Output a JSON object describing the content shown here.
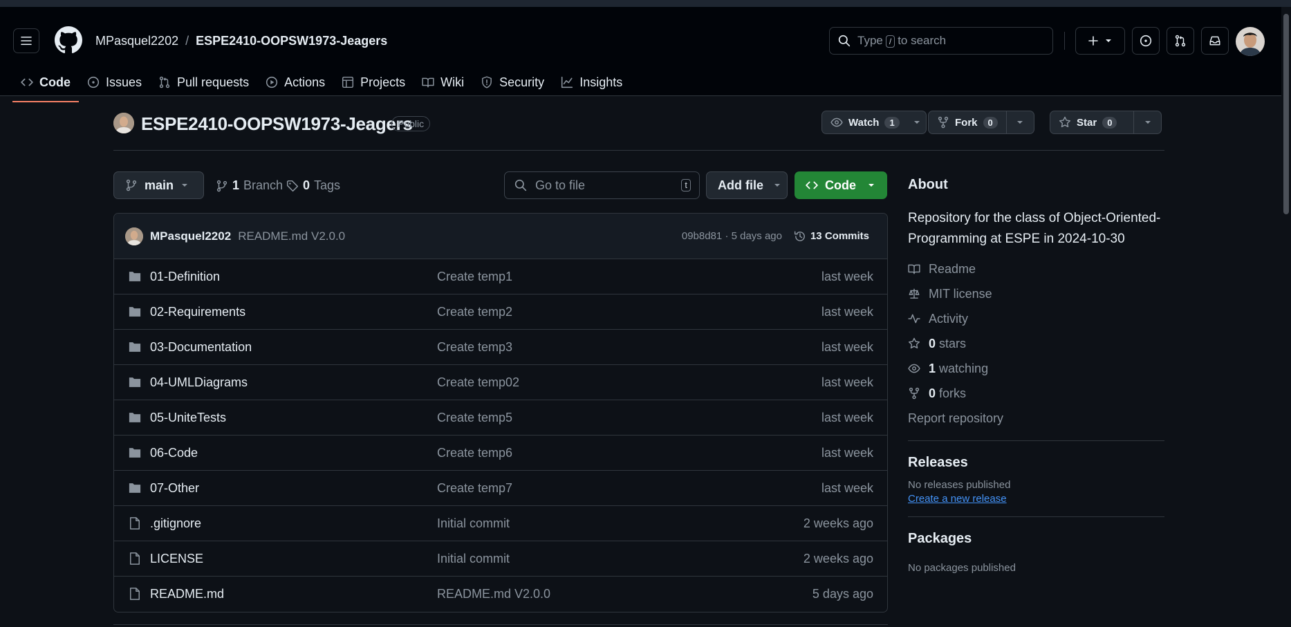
{
  "header": {
    "owner": "MPasquel2202",
    "separator": "/",
    "repo": "ESPE2410-OOPSW1973-Jeagers",
    "search_prefix": "Type",
    "search_key": "/",
    "search_suffix": "to search"
  },
  "tabs": [
    {
      "label": "Code",
      "icon": "code-icon"
    },
    {
      "label": "Issues",
      "icon": "issue-icon"
    },
    {
      "label": "Pull requests",
      "icon": "pull-request-icon"
    },
    {
      "label": "Actions",
      "icon": "play-icon"
    },
    {
      "label": "Projects",
      "icon": "table-icon"
    },
    {
      "label": "Wiki",
      "icon": "book-icon"
    },
    {
      "label": "Security",
      "icon": "shield-icon"
    },
    {
      "label": "Insights",
      "icon": "graph-icon"
    }
  ],
  "repo_header": {
    "title": "ESPE2410-OOPSW1973-Jeagers",
    "visibility": "Public",
    "watch_label": "Watch",
    "watch_count": "1",
    "fork_label": "Fork",
    "fork_count": "0",
    "star_label": "Star",
    "star_count": "0"
  },
  "controls": {
    "branch": "main",
    "branches_count": "1",
    "branches_label": "Branch",
    "tags_count": "0",
    "tags_label": "Tags",
    "go_to_file_placeholder": "Go to file",
    "go_to_file_key": "t",
    "add_file": "Add file",
    "code_button": "Code"
  },
  "latest_commit": {
    "author": "MPasquel2202",
    "message": "README.md V2.0.0",
    "hash_time": "09b8d81 · 5 days ago",
    "commits_label": "13 Commits"
  },
  "files": [
    {
      "type": "folder",
      "name": "01-Definition",
      "message": "Create temp1",
      "time": "last week"
    },
    {
      "type": "folder",
      "name": "02-Requirements",
      "message": "Create temp2",
      "time": "last week"
    },
    {
      "type": "folder",
      "name": "03-Documentation",
      "message": "Create temp3",
      "time": "last week"
    },
    {
      "type": "folder",
      "name": "04-UMLDiagrams",
      "message": "Create temp02",
      "time": "last week"
    },
    {
      "type": "folder",
      "name": "05-UniteTests",
      "message": "Create temp5",
      "time": "last week"
    },
    {
      "type": "folder",
      "name": "06-Code",
      "message": "Create temp6",
      "time": "last week"
    },
    {
      "type": "folder",
      "name": "07-Other",
      "message": "Create temp7",
      "time": "last week"
    },
    {
      "type": "file",
      "name": ".gitignore",
      "message": "Initial commit",
      "time": "2 weeks ago"
    },
    {
      "type": "file",
      "name": "LICENSE",
      "message": "Initial commit",
      "time": "2 weeks ago"
    },
    {
      "type": "file",
      "name": "README.md",
      "message": "README.md V2.0.0",
      "time": "5 days ago"
    }
  ],
  "about": {
    "heading": "About",
    "description": "Repository for the class of Object-Oriented-Programming at ESPE in 2024-10-30",
    "readme": "Readme",
    "license": "MIT license",
    "activity": "Activity",
    "stars_count": "0",
    "stars_label": "stars",
    "watching_count": "1",
    "watching_label": "watching",
    "forks_count": "0",
    "forks_label": "forks",
    "report": "Report repository"
  },
  "releases": {
    "heading": "Releases",
    "none": "No releases published",
    "create_link": "Create a new release"
  },
  "packages": {
    "heading": "Packages",
    "none": "No packages published"
  },
  "colors": {
    "background": "#0d1117",
    "header_bg": "#010409",
    "accent_tab": "#f78166",
    "code_button": "#238636",
    "link": "#4493f8"
  }
}
